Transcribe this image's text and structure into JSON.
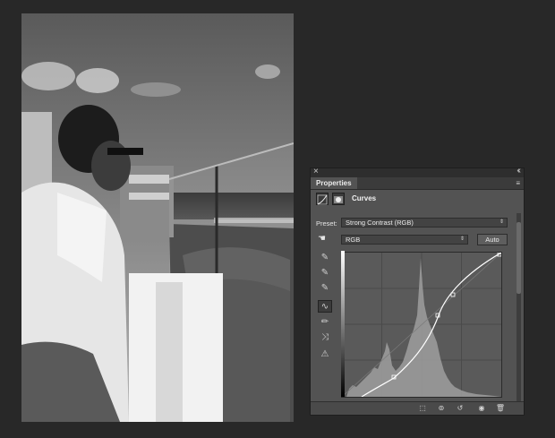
{
  "panel": {
    "close": "×",
    "collapse": "‹‹",
    "tab": "Properties",
    "menu": "≡",
    "adjustment_title": "Curves",
    "preset_label": "Preset:",
    "preset_value": "Strong Contrast (RGB)",
    "channel_value": "RGB",
    "auto_label": "Auto"
  },
  "icons": {
    "curves_adjustment": "curves-icon",
    "layer_mask": "mask-icon",
    "target_adjust": "hand-icon",
    "eyedropper_black": "eyedropper-icon",
    "eyedropper_gray": "eyedropper-icon",
    "eyedropper_white": "eyedropper-icon",
    "curve_tool": "curve-icon",
    "pencil_tool": "pencil-icon",
    "smooth_tool": "smooth-icon",
    "clipping_warning": "warning-icon",
    "clip_to_layer": "clip-icon",
    "view_previous": "eye-toggle-icon",
    "reset": "reset-icon",
    "visibility": "eye-icon",
    "delete": "trash-icon"
  },
  "colors": {
    "panel_bg": "#535353",
    "app_bg": "#282828"
  }
}
